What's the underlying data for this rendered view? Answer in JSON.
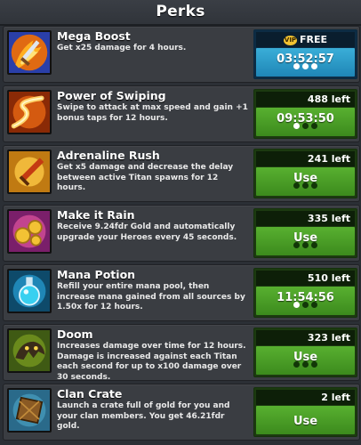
{
  "header": {
    "title": "Perks"
  },
  "perks": [
    {
      "name": "Mega Boost",
      "desc": "Get x25 damage for 4 hours.",
      "top": "FREE",
      "vip": "VIP",
      "main": "03:52:57",
      "style": "blue",
      "icon": "sword-fire-icon"
    },
    {
      "name": "Power of Swiping",
      "desc": "Swipe to attack at max speed and gain +1 bonus taps for 12 hours.",
      "top": "488 left",
      "main": "09:53:50",
      "style": "green",
      "icon": "swipe-trail-icon"
    },
    {
      "name": "Adrenaline Rush",
      "desc": "Get x5 damage and decrease the delay between active Titan spawns for 12 hours.",
      "top": "241 left",
      "main": "Use",
      "style": "green",
      "icon": "adrenaline-sword-icon"
    },
    {
      "name": "Make it Rain",
      "desc": "Receive 9.24fdr Gold and automatically upgrade your Heroes every 45 seconds.",
      "top": "335 left",
      "main": "Use",
      "style": "green",
      "icon": "gold-coins-icon"
    },
    {
      "name": "Mana Potion",
      "desc": "Refill your entire mana pool, then increase mana gained from all sources by 1.50x for 12 hours.",
      "top": "510 left",
      "main": "11:54:56",
      "style": "green",
      "icon": "mana-potion-icon"
    },
    {
      "name": "Doom",
      "desc": "Increases damage over time for 12 hours. Damage is increased against each Titan each second for up to x100 damage over 30 seconds.",
      "top": "323 left",
      "main": "Use",
      "style": "green",
      "icon": "doom-monster-icon"
    },
    {
      "name": "Clan Crate",
      "desc": "Launch a crate full of gold for you and your clan members. You get 46.21fdr gold.",
      "top": "2 left",
      "main": "Use",
      "style": "green",
      "icon": "clan-crate-icon"
    }
  ]
}
